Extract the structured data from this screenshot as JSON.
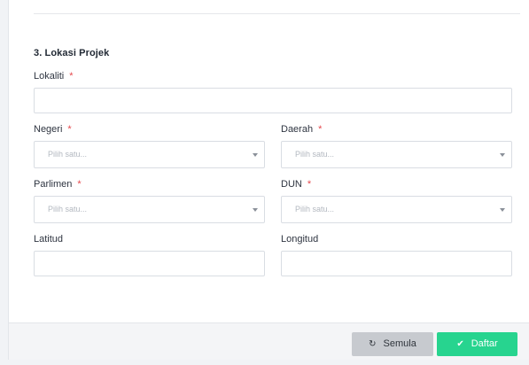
{
  "section": {
    "title": "3. Lokasi Projek"
  },
  "fields": {
    "lokaliti": {
      "label": "Lokaliti",
      "required_mark": "*",
      "value": ""
    },
    "negeri": {
      "label": "Negeri",
      "required_mark": "*",
      "placeholder": "Pilih satu..."
    },
    "daerah": {
      "label": "Daerah",
      "required_mark": "*",
      "placeholder": "Pilih satu..."
    },
    "parlimen": {
      "label": "Parlimen",
      "required_mark": "*",
      "placeholder": "Pilih satu..."
    },
    "dun": {
      "label": "DUN",
      "required_mark": "*",
      "placeholder": "Pilih satu..."
    },
    "latitud": {
      "label": "Latitud",
      "value": ""
    },
    "longitud": {
      "label": "Longitud",
      "value": ""
    }
  },
  "footer": {
    "reset_label": "Semula",
    "reset_icon": "refresh-icon",
    "submit_label": "Daftar",
    "submit_icon": "check-circle-icon"
  },
  "colors": {
    "required": "#e5484d",
    "submit": "#27d48f",
    "reset": "#c7cacf"
  }
}
